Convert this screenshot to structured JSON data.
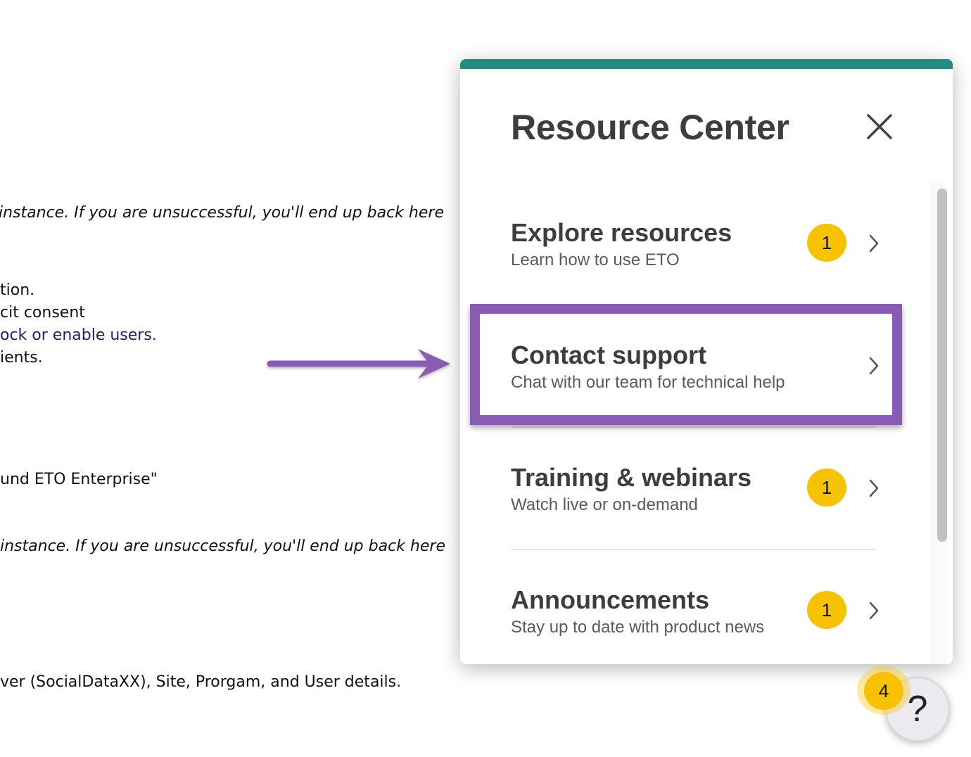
{
  "background_text": {
    "line1": " instance. If you are unsuccessful, you'll end up back here",
    "line2": "tion.",
    "line3": "cit consent",
    "line4": "ock or enable users.",
    "line5": "ients.",
    "line6": "und ETO Enterprise\"",
    "line7": " instance. If you are unsuccessful, you'll end up back here",
    "line8": "ver (SocialDataXX), Site, Prorgam, and User details."
  },
  "resource_center": {
    "title": "Resource Center",
    "close_icon": "close-icon",
    "items": [
      {
        "title": "Explore resources",
        "subtitle": "Learn how to use ETO",
        "badge": "1"
      },
      {
        "title": "Contact support",
        "subtitle": "Chat with our team for technical help",
        "badge": ""
      },
      {
        "title": "Training & webinars",
        "subtitle": "Watch live or on-demand",
        "badge": "1"
      },
      {
        "title": "Announcements",
        "subtitle": "Stay up to date with product news",
        "badge": "1"
      }
    ]
  },
  "help_button": {
    "glyph": "?",
    "badge": "4"
  },
  "colors": {
    "accent_bar": "#1f8e7e",
    "badge": "#f7c200",
    "highlight": "#8a5bb5"
  }
}
